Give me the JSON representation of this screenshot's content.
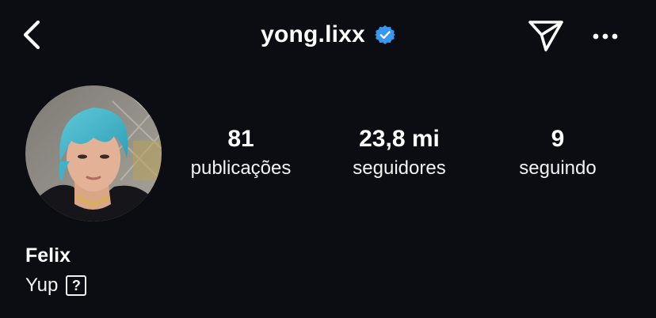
{
  "header": {
    "username": "yong.lixx",
    "icons": {
      "back": "chevron-left-icon",
      "verified": "verified-badge-icon",
      "send": "paper-plane-icon",
      "more": "more-horizontal-icon"
    }
  },
  "colors": {
    "background": "#0b0d12",
    "text": "#ffffff",
    "verified": "#3897f0"
  },
  "profile": {
    "avatar": "profile-photo",
    "stats": [
      {
        "value": "81",
        "label": "publicações"
      },
      {
        "value": "23,8 mi",
        "label": "seguidores"
      },
      {
        "value": "9",
        "label": "seguindo"
      }
    ],
    "display_name": "Felix",
    "bio_text": "Yup",
    "bio_glyph": "?"
  }
}
